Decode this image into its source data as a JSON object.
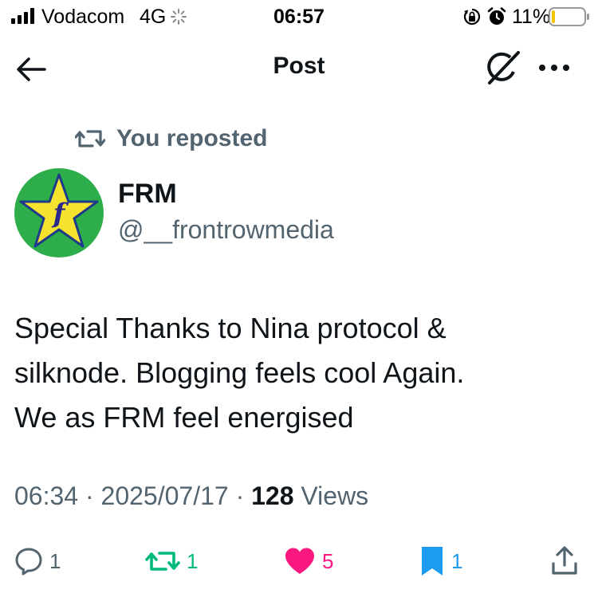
{
  "status_bar": {
    "carrier": "Vodacom",
    "network": "4G",
    "time": "06:57",
    "battery": "11%",
    "battery_level": 0.11
  },
  "nav": {
    "title": "Post"
  },
  "repost": {
    "label": "You reposted"
  },
  "author": {
    "name": "FRM",
    "handle": "@__frontrowmedia"
  },
  "post": {
    "lines": [
      "Special Thanks to Nina protocol &",
      "silknode. Blogging feels cool Again.",
      "We as FRM feel energised"
    ]
  },
  "meta": {
    "time": "06:34",
    "separator": " · ",
    "date": "2025/07/17",
    "views_count": "128",
    "views_label": " Views"
  },
  "actions": {
    "replies": "1",
    "reposts": "1",
    "likes": "5",
    "bookmarks": "1"
  },
  "colors": {
    "text": "#0f1419",
    "muted": "#536471",
    "repost_green": "#00ba7c",
    "like_pink": "#f91880",
    "bookmark_blue": "#1d9bf0",
    "avatar_green": "#2eae4a",
    "avatar_star": "#f5e330"
  },
  "icons": [
    "signal-icon",
    "loading-spinner-icon",
    "rotation-lock-icon",
    "alarm-icon",
    "battery-icon",
    "back-arrow-icon",
    "grok-icon",
    "more-icon",
    "repost-icon",
    "reply-icon",
    "like-icon",
    "bookmark-icon",
    "share-icon"
  ]
}
